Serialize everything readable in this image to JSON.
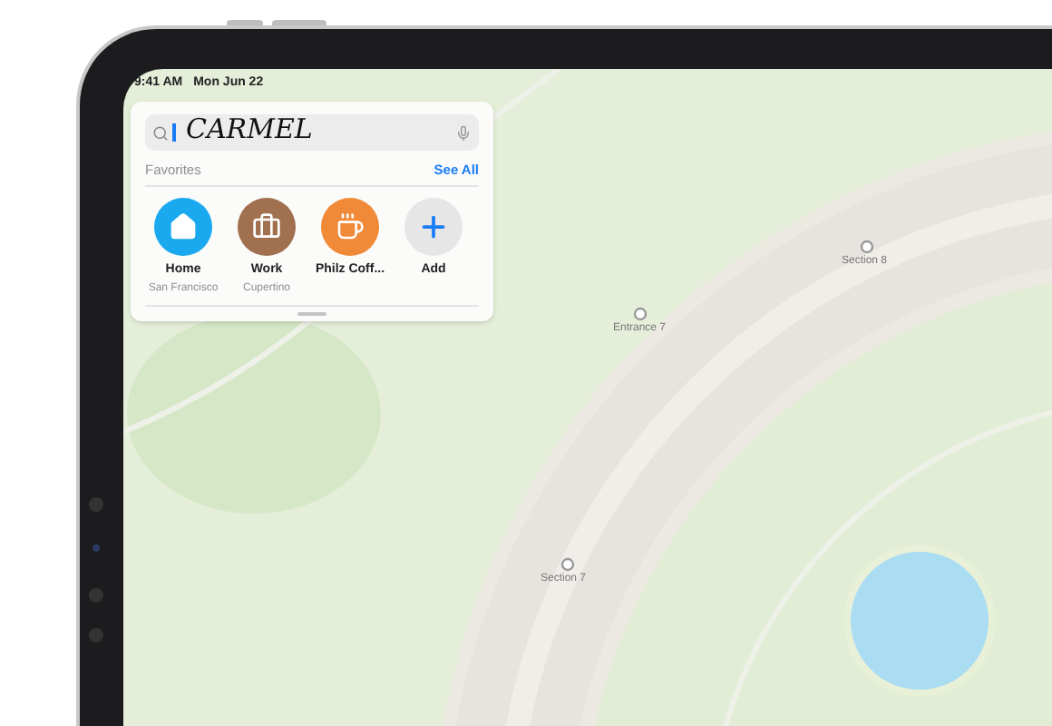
{
  "status_bar": {
    "time": "9:41 AM",
    "date": "Mon Jun 22"
  },
  "search": {
    "value": "CARMEL"
  },
  "favorites": {
    "title": "Favorites",
    "see_all": "See All",
    "items": [
      {
        "kind": "home",
        "name": "Home",
        "subtitle": "San Francisco",
        "color": "#1aa9ee"
      },
      {
        "kind": "work",
        "name": "Work",
        "subtitle": "Cupertino",
        "color": "#a0704f"
      },
      {
        "kind": "coffee",
        "name": "Philz Coff...",
        "color": "#f08a38"
      },
      {
        "kind": "add",
        "name": "Add",
        "color": "#e6e6e6"
      }
    ]
  },
  "map_labels": [
    {
      "text": "Entrance 7"
    },
    {
      "text": "Section 8"
    },
    {
      "text": "Section 7"
    }
  ]
}
